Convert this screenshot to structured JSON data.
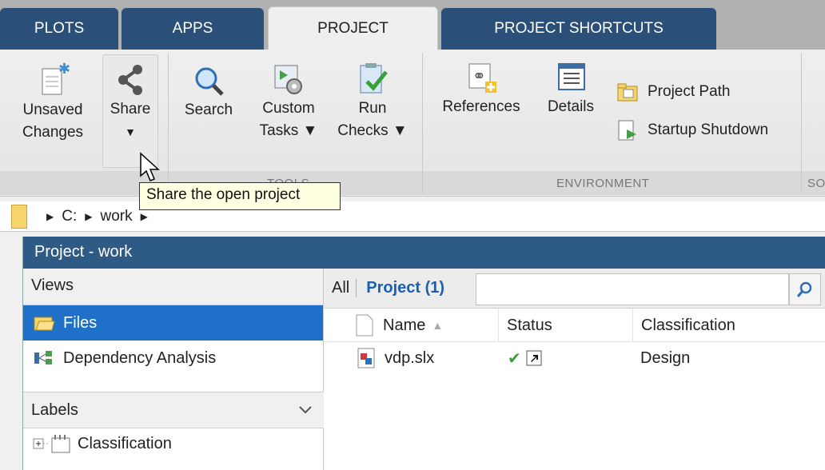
{
  "tabs": [
    {
      "label": "PLOTS"
    },
    {
      "label": "APPS"
    },
    {
      "label": "PROJECT"
    },
    {
      "label": "PROJECT SHORTCUTS"
    }
  ],
  "ribbon": {
    "unsaved_changes": {
      "line1": "Unsaved",
      "line2": "Changes"
    },
    "share": {
      "label": "Share",
      "caret": "▼"
    },
    "search": {
      "label": "Search"
    },
    "custom_tasks": {
      "line1": "Custom",
      "line2": "Tasks ▼"
    },
    "run_checks": {
      "line1": "Run",
      "line2": "Checks ▼"
    },
    "references": {
      "label": "References"
    },
    "details": {
      "label": "Details"
    },
    "project_path": {
      "label": "Project Path"
    },
    "startup_shutdown": {
      "label": "Startup Shutdown"
    },
    "group_tools": "TOOLS",
    "group_environment": "ENVIRONMENT",
    "group_partial": "SO"
  },
  "tooltip": "Share the open project",
  "address": {
    "parts": [
      "C:",
      "work"
    ]
  },
  "project_window": {
    "title": "Project - work",
    "views_header": "Views",
    "views": [
      {
        "label": "Files",
        "selected": true
      },
      {
        "label": "Dependency Analysis",
        "selected": false
      }
    ],
    "labels_header": "Labels",
    "labels": [
      {
        "label": "Classification"
      }
    ],
    "filter": {
      "all": "All",
      "project": "Project (1)"
    },
    "columns": [
      "Name",
      "Status",
      "Classification"
    ],
    "rows": [
      {
        "name": "vdp.slx",
        "status_check": "✔",
        "classification": "Design"
      }
    ]
  },
  "colors": {
    "accent": "#1f70c9",
    "tab_dark": "#2a5079",
    "title_bar": "#2e5a86"
  }
}
